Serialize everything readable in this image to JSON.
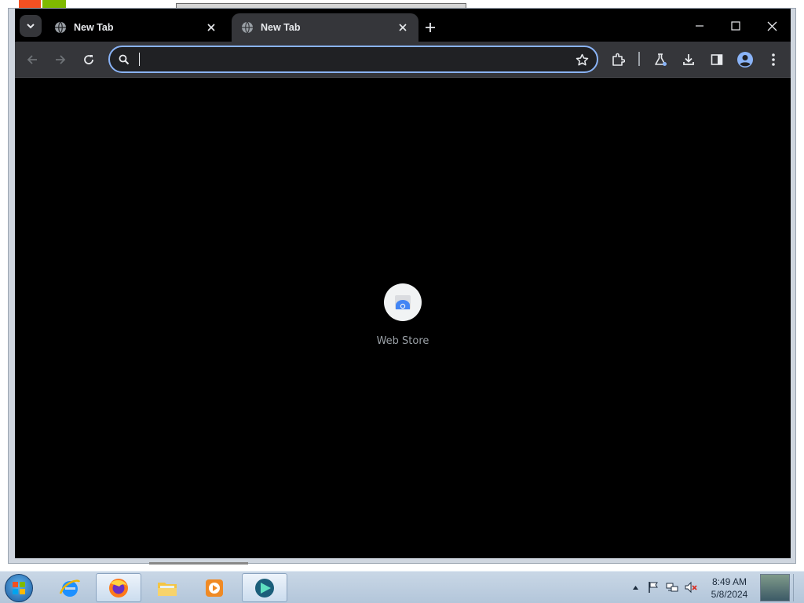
{
  "browser": {
    "tabs": [
      {
        "title": "New Tab",
        "active": false
      },
      {
        "title": "New Tab",
        "active": true
      }
    ],
    "omnibox": {
      "value": "",
      "placeholder": ""
    },
    "shortcut": {
      "label": "Web Store"
    }
  },
  "taskbar": {
    "clock": {
      "time": "8:49 AM",
      "date": "5/8/2024"
    }
  },
  "colors": {
    "accent": "#8ab4f8",
    "toolbar": "#35363a",
    "page_bg": "#000000"
  },
  "icons": [
    "tab-search-icon",
    "globe-icon",
    "close-icon",
    "plus-icon",
    "minimize-icon",
    "maximize-icon",
    "back-arrow-icon",
    "forward-arrow-icon",
    "reload-icon",
    "search-icon",
    "star-icon",
    "extensions-icon",
    "labs-flask-icon",
    "download-icon",
    "side-panel-icon",
    "profile-icon",
    "more-menu-icon",
    "web-store-icon",
    "windows-start-icon",
    "internet-explorer-icon",
    "firefox-icon",
    "file-explorer-icon",
    "media-player-icon",
    "app-icon",
    "tray-arrow-icon",
    "action-center-flag-icon",
    "network-icon",
    "volume-muted-icon"
  ]
}
